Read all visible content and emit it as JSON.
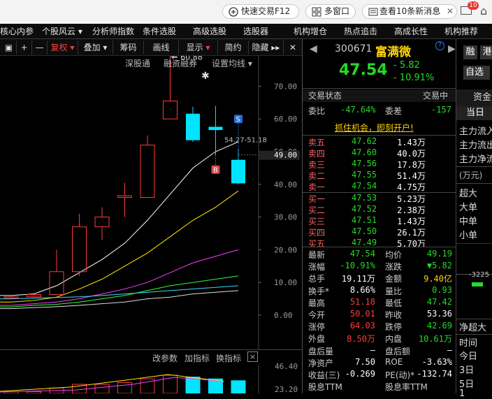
{
  "titlebar": {
    "quick_trade": "快速交易F12",
    "multi_window": "多窗口",
    "news": "查看10条新消息",
    "news_badge": "10",
    "minimize": "—"
  },
  "menu": [
    "核心内参",
    "个股风云 ▾",
    "分析师指数",
    "条件选股",
    "高级选股",
    "选股器",
    "机构增仓",
    "热点追击",
    "高成长性",
    "机构推荐"
  ],
  "toolbar": {
    "period": "复权",
    "overlay": "叠加",
    "chips": "筹码",
    "draw": "画线",
    "display": "显示",
    "simple": "简约",
    "hide": "隐藏"
  },
  "chart_links": {
    "shenzhen": "深股通",
    "margin": "融资融券",
    "ma_setting": "设置均线 ▾"
  },
  "chart_annotations": {
    "high": "60.88",
    "range": "54.27-51.18",
    "current": "49.00",
    "s_mark": "S",
    "b_mark": "B"
  },
  "subchart": {
    "params": "改参数",
    "add": "加指标",
    "switch": "换指标",
    "close": "×",
    "y_top": "46.40",
    "y_bottom": "23.20"
  },
  "chart_data": {
    "type": "candlestick",
    "yticks": [
      "70.00",
      "60.00",
      "50.00",
      "40.00",
      "30.00",
      "20.00",
      "10.00",
      "0.00"
    ],
    "ylim": [
      0,
      75
    ],
    "candles": [
      {
        "o": 5.2,
        "c": 5.6,
        "h": 6,
        "l": 4.8
      },
      {
        "o": 5.6,
        "c": 6.3,
        "h": 6.5,
        "l": 5.3
      },
      {
        "o": 6.3,
        "c": 13.3,
        "h": 20,
        "l": 6.2
      },
      {
        "o": 13.3,
        "c": 27,
        "h": 31,
        "l": 12
      },
      {
        "o": 27,
        "c": 30,
        "h": 33,
        "l": 23
      },
      {
        "o": 36,
        "c": 36.5,
        "h": 40.5,
        "l": 30
      },
      {
        "o": 36,
        "c": 52,
        "h": 55,
        "l": 36
      },
      {
        "o": 60,
        "c": 65.5,
        "h": 79,
        "l": 60
      },
      {
        "o": 61.6,
        "c": 53.5,
        "h": 63.7,
        "l": 53
      },
      {
        "o": 57.6,
        "c": 56.6,
        "h": 64,
        "l": 49
      },
      {
        "o": 47.5,
        "c": 40.3,
        "h": 51,
        "l": 40
      }
    ],
    "ma": [
      {
        "color": "#ffffff",
        "values": [
          6,
          6.5,
          9,
          13,
          17,
          22,
          29,
          37,
          45,
          50,
          53
        ]
      },
      {
        "color": "#ffea00",
        "values": [
          4,
          4.5,
          5.5,
          8,
          11,
          15,
          19,
          24,
          29,
          33,
          38
        ]
      },
      {
        "color": "#ff3cff",
        "values": [
          3,
          3.5,
          4,
          5,
          6.5,
          8,
          10,
          13,
          16,
          18,
          20
        ]
      },
      {
        "color": "#33ff33",
        "values": [
          2.5,
          3,
          3.3,
          4,
          5,
          6,
          7.5,
          9,
          10,
          11,
          12
        ]
      },
      {
        "color": "#33ddff",
        "values": [
          5,
          5.2,
          5.4,
          5.6,
          6,
          6.5,
          7,
          7.5,
          8,
          8.5,
          9
        ]
      },
      {
        "color": "#dddddd",
        "values": [
          2,
          2.3,
          2.6,
          3,
          3.5,
          4,
          5,
          5.5,
          6.5,
          7,
          7.5
        ]
      }
    ]
  },
  "quote": {
    "code": "300671",
    "name": "富满微",
    "price": "47.54",
    "change": "- 5.82",
    "pct": "- 10.91%",
    "btn_finance": "融",
    "btn_hk": "港",
    "btn_watch": "自选",
    "btn_add": "+"
  },
  "status": {
    "label": "交易状态",
    "value": "交易中",
    "wb_label": "委比",
    "wb": "-47.64%",
    "wc_label": "委差",
    "wc": "-157",
    "promo": "抓住机会，即刻开户!"
  },
  "asks": [
    {
      "label": "卖五",
      "price": "47.62",
      "vol": "1.43万"
    },
    {
      "label": "卖四",
      "price": "47.60",
      "vol": "40.0万"
    },
    {
      "label": "卖三",
      "price": "47.56",
      "vol": "17.8万"
    },
    {
      "label": "卖二",
      "price": "47.55",
      "vol": "51.4万"
    },
    {
      "label": "卖一",
      "price": "47.54",
      "vol": "4.75万"
    }
  ],
  "bids": [
    {
      "label": "买一",
      "price": "47.53",
      "vol": "5.23万"
    },
    {
      "label": "买二",
      "price": "47.52",
      "vol": "2.38万"
    },
    {
      "label": "买三",
      "price": "47.51",
      "vol": "1.43万"
    },
    {
      "label": "买四",
      "price": "47.50",
      "vol": "26.1万"
    },
    {
      "label": "买五",
      "price": "47.49",
      "vol": "5.70万"
    }
  ],
  "stats": [
    [
      "最新",
      "47.54",
      "均价",
      "49.19"
    ],
    [
      "涨幅",
      "-10.91%",
      "涨跌",
      "▼5.82"
    ],
    [
      "总手",
      "19.11万",
      "金额",
      "9.40亿"
    ],
    [
      "换手*",
      "8.66%",
      "量比",
      "0.93"
    ],
    [
      "最高",
      "51.18",
      "最低",
      "47.42"
    ],
    [
      "今开",
      "50.01",
      "昨收",
      "53.36"
    ],
    [
      "涨停",
      "64.03",
      "跌停",
      "42.69"
    ],
    [
      "外盘",
      "8.50万",
      "内盘",
      "10.61万"
    ],
    [
      "盘后量",
      "—",
      "盘后额",
      "—"
    ],
    [
      "净资产",
      "7.50",
      "ROE",
      "-3.63%"
    ],
    [
      "收益(三)",
      "-0.269",
      "PE(动)*",
      "-132.74"
    ],
    [
      "股息TTM",
      "",
      "股息率TTM",
      ""
    ]
  ],
  "right": {
    "tab_fund": "资金",
    "tab_today": "当日",
    "items": [
      "主力流入",
      "主力流出",
      "主力净流",
      "(万元)",
      "超大",
      "大单",
      "中单",
      "小单"
    ],
    "bar_value": "-3225",
    "net_super": "净超大",
    "time": "时间",
    "rows": [
      "今日",
      "3日",
      "5日",
      "1"
    ]
  },
  "colors": {
    "up": "#ff3a3a",
    "down": "#00e5ff",
    "green": "#26d926",
    "accent": "#ffd400"
  }
}
